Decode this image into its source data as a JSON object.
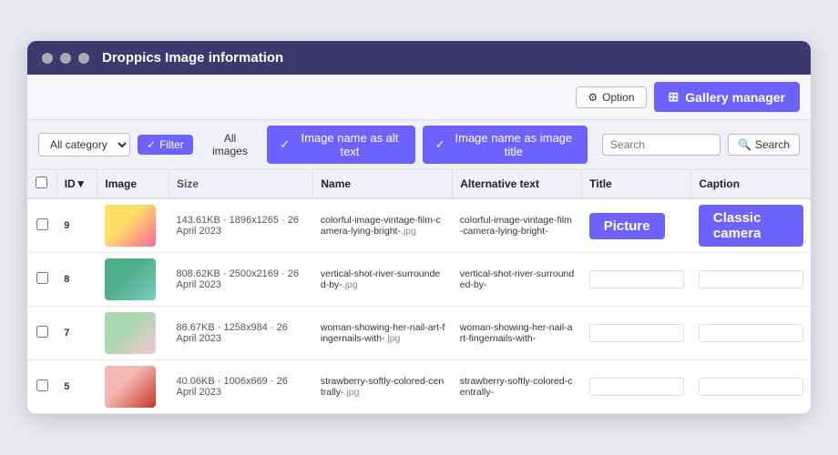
{
  "window": {
    "title": "Droppics Image information",
    "dots": [
      "dot1",
      "dot2",
      "dot3"
    ]
  },
  "topbar": {
    "option_label": "Option",
    "gallery_manager_label": "Gallery manager"
  },
  "toolbar": {
    "category_value": "All category",
    "filter_label": "Filter",
    "all_images_label": "All images",
    "alt_text_toggle": "Image name as alt text",
    "image_title_toggle": "Image name as image title",
    "search_placeholder": "Search",
    "search_label": "Search"
  },
  "table": {
    "columns": [
      "",
      "ID▼",
      "Image",
      "Size",
      "Name",
      "Alternative text",
      "Title",
      "Caption"
    ],
    "rows": [
      {
        "id": "9",
        "size": "143.61KB · 1896x1265 · 26 April 2023",
        "name_prefix": "colorful-image-vintage-film-camera-lying-bright-",
        "name_ext": ".jpg",
        "alt_prefix": "colorful-image-vintage-film-camera-lying-bright-",
        "title_value": "Picture",
        "caption_value": "Classic camera",
        "img_class": "img-1"
      },
      {
        "id": "8",
        "size": "808.62KB · 2500x2169 · 26 April 2023",
        "name_prefix": "vertical-shot-river-surrounded-by-",
        "name_ext": ".jpg",
        "alt_prefix": "vertical-shot-river-surrounded-by-",
        "title_value": "",
        "caption_value": "",
        "img_class": "img-2"
      },
      {
        "id": "7",
        "size": "86.67KB · 1258x984 · 26 April 2023",
        "name_prefix": "woman-showing-her-nail-art-fingernails-with-",
        "name_ext": ".jpg",
        "alt_prefix": "woman-showing-her-nail-art-fingernails-with-",
        "title_value": "",
        "caption_value": "",
        "img_class": "img-3"
      },
      {
        "id": "5",
        "size": "40.06KB · 1006x669 · 26 April 2023",
        "name_prefix": "strawberry-softly-colored-centrally-",
        "name_ext": ".jpg",
        "alt_prefix": "strawberry-softly-colored-centrally-",
        "title_value": "",
        "caption_value": "",
        "img_class": "img-4"
      }
    ]
  }
}
